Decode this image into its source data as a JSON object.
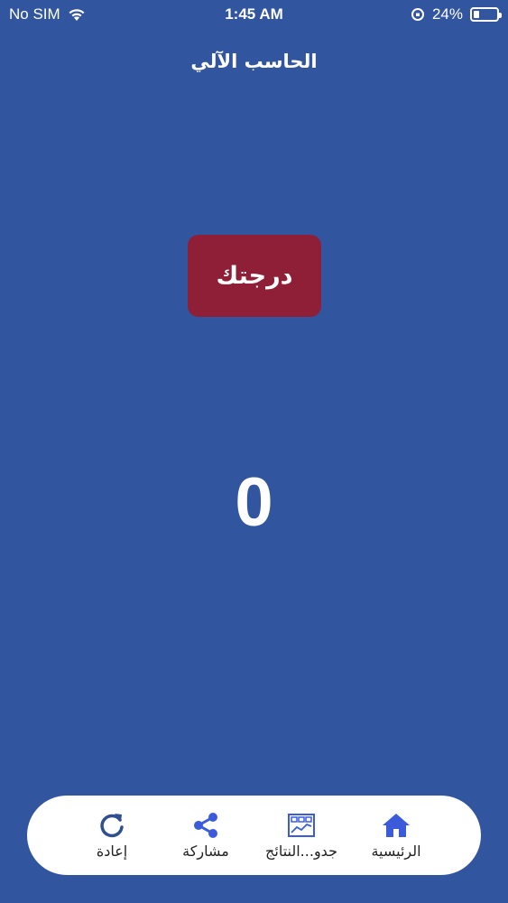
{
  "status_bar": {
    "carrier": "No SIM",
    "time": "1:45 AM",
    "battery_percent": "24%",
    "battery_level": 0.24
  },
  "header": {
    "title": "الحاسب الآلي"
  },
  "main": {
    "score_button_label": "درجتك",
    "score_value": "0"
  },
  "bottom_nav": {
    "items": [
      {
        "label": "الرئيسية",
        "icon": "home-icon"
      },
      {
        "label": "جدو...النتائج",
        "icon": "results-table-icon"
      },
      {
        "label": "مشاركة",
        "icon": "share-icon"
      },
      {
        "label": "إعادة",
        "icon": "refresh-icon"
      }
    ]
  },
  "colors": {
    "background": "#32559f",
    "score_button": "#8f1f36",
    "icon_accent": "#3b5bdb"
  }
}
